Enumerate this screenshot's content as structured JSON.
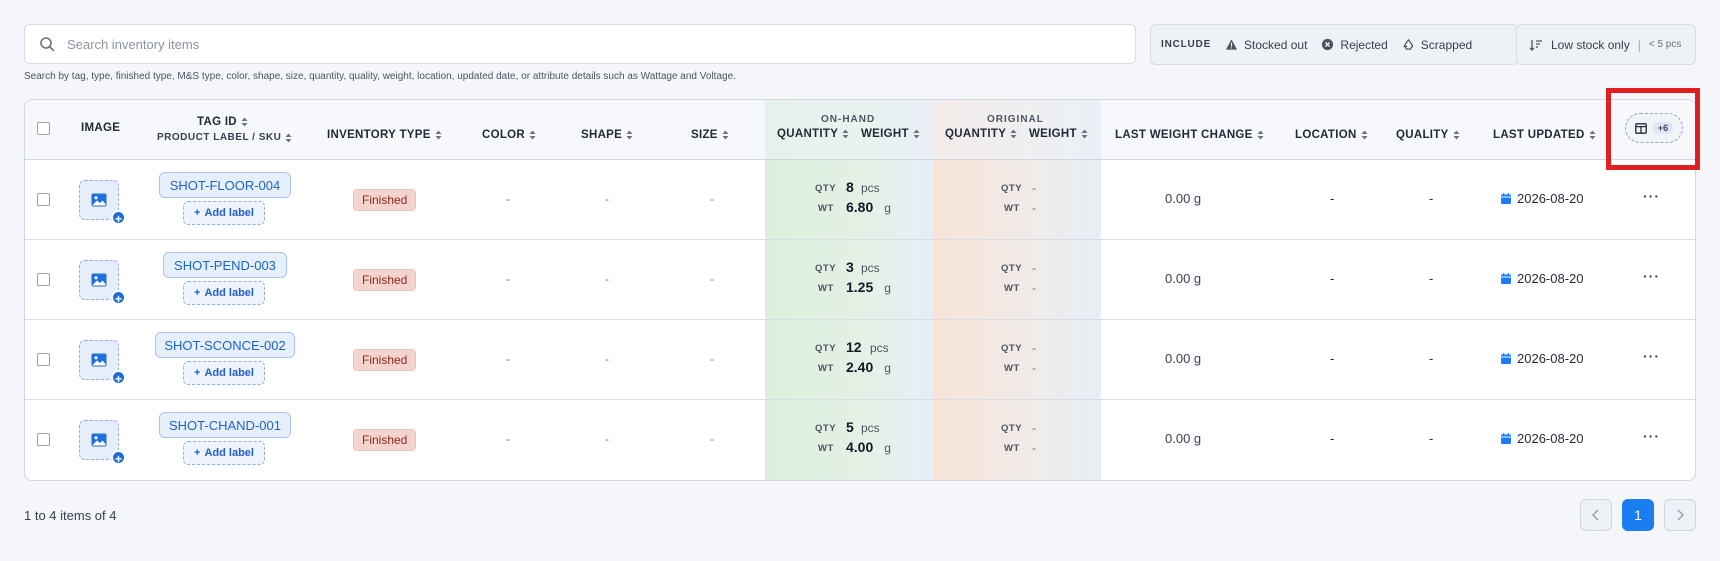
{
  "search": {
    "placeholder": "Search inventory items",
    "hint": "Search by tag, type, finished type, M&S type, color, shape, size, quantity, quality, weight, location, updated date, or attribute details such as Wattage and Voltage."
  },
  "include": {
    "label": "INCLUDE",
    "options": [
      {
        "label": "Stocked out",
        "icon": "warning-triangle-icon"
      },
      {
        "label": "Rejected",
        "icon": "x-circle-icon"
      },
      {
        "label": "Scrapped",
        "icon": "recycle-icon"
      }
    ]
  },
  "low_stock": {
    "label": "Low stock only",
    "threshold": "< 5 pcs"
  },
  "columns": {
    "image": "IMAGE",
    "tag_id": "TAG ID",
    "product_label": "PRODUCT LABEL / SKU",
    "inventory_type": "INVENTORY TYPE",
    "color": "COLOR",
    "shape": "SHAPE",
    "size": "SIZE",
    "on_hand": "ON-HAND",
    "original": "ORIGINAL",
    "quantity": "QUANTITY",
    "weight": "WEIGHT",
    "last_weight_change": "LAST WEIGHT CHANGE",
    "location": "LOCATION",
    "quality": "QUALITY",
    "last_updated": "LAST UPDATED",
    "hidden_count": "+6"
  },
  "labels": {
    "add_label": "Add label",
    "qty": "QTY",
    "wt": "WT",
    "pcs": "pcs",
    "g": "g"
  },
  "rows": [
    {
      "tag": "SHOT-FLOOR-004",
      "type": "Finished",
      "color": "-",
      "shape": "-",
      "size": "-",
      "qty": "8",
      "wt": "6.80",
      "orig_qty": "-",
      "orig_wt": "-",
      "last_weight_change": "0.00 g",
      "location": "-",
      "quality": "-",
      "updated": "2026-08-20"
    },
    {
      "tag": "SHOT-PEND-003",
      "type": "Finished",
      "color": "-",
      "shape": "-",
      "size": "-",
      "qty": "3",
      "wt": "1.25",
      "orig_qty": "-",
      "orig_wt": "-",
      "last_weight_change": "0.00 g",
      "location": "-",
      "quality": "-",
      "updated": "2026-08-20"
    },
    {
      "tag": "SHOT-SCONCE-002",
      "type": "Finished",
      "color": "-",
      "shape": "-",
      "size": "-",
      "qty": "12",
      "wt": "2.40",
      "orig_qty": "-",
      "orig_wt": "-",
      "last_weight_change": "0.00 g",
      "location": "-",
      "quality": "-",
      "updated": "2026-08-20"
    },
    {
      "tag": "SHOT-CHAND-001",
      "type": "Finished",
      "color": "-",
      "shape": "-",
      "size": "-",
      "qty": "5",
      "wt": "4.00",
      "orig_qty": "-",
      "orig_wt": "-",
      "last_weight_change": "0.00 g",
      "location": "-",
      "quality": "-",
      "updated": "2026-08-20"
    }
  ],
  "footer": {
    "summary": "1 to 4 items of 4",
    "current_page": "1"
  },
  "colors": {
    "accent": "#1a7ef0",
    "highlight": "#e02020"
  }
}
